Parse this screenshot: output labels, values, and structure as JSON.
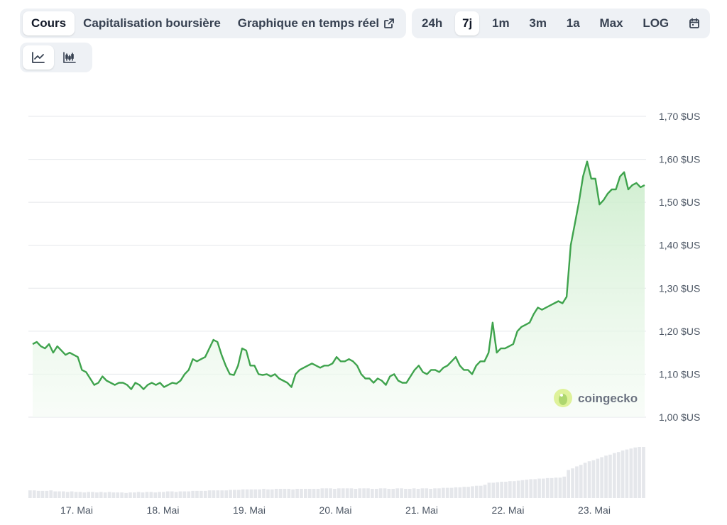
{
  "tabs": {
    "price": "Cours",
    "market_cap": "Capitalisation boursière",
    "live_chart": "Graphique en temps réel",
    "ranges": [
      "24h",
      "7j",
      "1m",
      "3m",
      "1a",
      "Max",
      "LOG"
    ],
    "active_range": "7j",
    "icons": {
      "external_link": "external-link-icon",
      "calendar": "calendar-icon",
      "line_chart": "line-chart-icon",
      "candlestick": "candlestick-chart-icon"
    }
  },
  "watermark": "coingecko",
  "colors": {
    "line": "#3fa34d",
    "fill_top": "#c9ecc9",
    "volume": "#e5e7eb",
    "grid": "#e5e7eb"
  },
  "chart_data": {
    "type": "line",
    "y_unit": "$US",
    "ylim": [
      1.0,
      1.7
    ],
    "yticks": [
      "1,70 $US",
      "1,60 $US",
      "1,50 $US",
      "1,40 $US",
      "1,30 $US",
      "1,20 $US",
      "1,10 $US",
      "1,00 $US"
    ],
    "xticks": [
      "17. Mai",
      "18. Mai",
      "19. Mai",
      "20. Mai",
      "21. Mai",
      "22. Mai",
      "23. Mai"
    ],
    "grid": true,
    "series": [
      {
        "values": [
          1.17,
          1.175,
          1.165,
          1.16,
          1.17,
          1.15,
          1.165,
          1.155,
          1.145,
          1.15,
          1.145,
          1.14,
          1.11,
          1.105,
          1.09,
          1.075,
          1.08,
          1.095,
          1.085,
          1.08,
          1.075,
          1.08,
          1.08,
          1.075,
          1.065,
          1.08,
          1.075,
          1.065,
          1.075,
          1.08,
          1.075,
          1.08,
          1.07,
          1.075,
          1.08,
          1.078,
          1.085,
          1.1,
          1.11,
          1.135,
          1.13,
          1.135,
          1.14,
          1.16,
          1.18,
          1.175,
          1.145,
          1.12,
          1.1,
          1.098,
          1.12,
          1.16,
          1.155,
          1.12,
          1.12,
          1.1,
          1.098,
          1.1,
          1.095,
          1.1,
          1.09,
          1.085,
          1.08,
          1.07,
          1.1,
          1.11,
          1.115,
          1.12,
          1.125,
          1.12,
          1.115,
          1.12,
          1.12,
          1.125,
          1.14,
          1.13,
          1.13,
          1.135,
          1.13,
          1.12,
          1.1,
          1.09,
          1.09,
          1.08,
          1.09,
          1.085,
          1.075,
          1.095,
          1.1,
          1.085,
          1.08,
          1.08,
          1.095,
          1.11,
          1.12,
          1.105,
          1.1,
          1.11,
          1.11,
          1.105,
          1.115,
          1.12,
          1.13,
          1.14,
          1.12,
          1.11,
          1.11,
          1.1,
          1.12,
          1.13,
          1.13,
          1.15,
          1.22,
          1.15,
          1.16,
          1.16,
          1.165,
          1.17,
          1.2,
          1.21,
          1.215,
          1.22,
          1.24,
          1.255,
          1.25,
          1.255,
          1.26,
          1.265,
          1.27,
          1.265,
          1.28,
          1.4,
          1.45,
          1.5,
          1.56,
          1.595,
          1.555,
          1.555,
          1.495,
          1.505,
          1.52,
          1.53,
          1.53,
          1.56,
          1.57,
          1.53,
          1.54,
          1.545,
          1.535,
          1.54
        ]
      }
    ],
    "volume_relative": [
      0.15,
      0.15,
      0.14,
      0.14,
      0.14,
      0.15,
      0.13,
      0.13,
      0.13,
      0.12,
      0.13,
      0.12,
      0.12,
      0.11,
      0.12,
      0.12,
      0.11,
      0.12,
      0.11,
      0.12,
      0.11,
      0.11,
      0.11,
      0.1,
      0.11,
      0.11,
      0.12,
      0.11,
      0.12,
      0.12,
      0.11,
      0.12,
      0.12,
      0.13,
      0.13,
      0.12,
      0.13,
      0.13,
      0.13,
      0.14,
      0.14,
      0.14,
      0.14,
      0.15,
      0.15,
      0.15,
      0.15,
      0.15,
      0.16,
      0.16,
      0.16,
      0.17,
      0.17,
      0.17,
      0.17,
      0.17,
      0.18,
      0.17,
      0.17,
      0.18,
      0.18,
      0.18,
      0.18,
      0.17,
      0.18,
      0.18,
      0.18,
      0.18,
      0.18,
      0.18,
      0.19,
      0.19,
      0.19,
      0.18,
      0.19,
      0.19,
      0.19,
      0.19,
      0.18,
      0.19,
      0.19,
      0.19,
      0.18,
      0.18,
      0.19,
      0.19,
      0.18,
      0.18,
      0.19,
      0.19,
      0.18,
      0.18,
      0.19,
      0.18,
      0.19,
      0.19,
      0.18,
      0.19,
      0.19,
      0.2,
      0.2,
      0.2,
      0.21,
      0.21,
      0.22,
      0.22,
      0.23,
      0.24,
      0.24,
      0.26,
      0.3,
      0.3,
      0.31,
      0.32,
      0.32,
      0.33,
      0.33,
      0.34,
      0.35,
      0.36,
      0.37,
      0.37,
      0.38,
      0.38,
      0.39,
      0.39,
      0.4,
      0.4,
      0.42,
      0.55,
      0.58,
      0.62,
      0.65,
      0.69,
      0.72,
      0.74,
      0.77,
      0.8,
      0.83,
      0.85,
      0.88,
      0.9,
      0.93,
      0.95,
      0.97,
      0.99,
      1.0,
      1.0
    ]
  }
}
